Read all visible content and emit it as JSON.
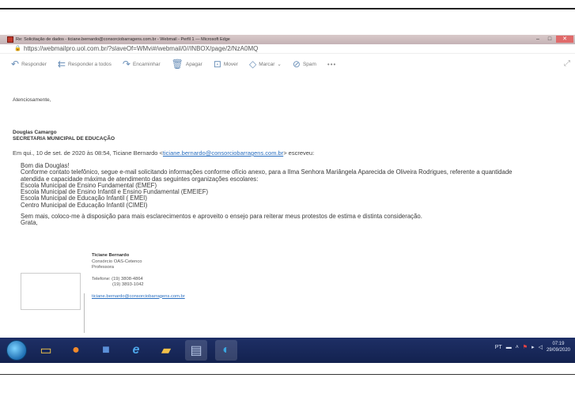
{
  "window": {
    "title": "Re: Solicitação de dados - ticiane.bernardo@consorciobarragens.com.br - Webmail - Perfil 1 — Microsoft Edge",
    "minimize": "–",
    "maximize": "□",
    "close": "✕"
  },
  "address": {
    "url": "https://webmailpro.uol.com.br/?slaveOf=WMvi#/webmail/0//INBOX/page/2/NzA0MQ"
  },
  "toolbar": {
    "reply": "Responder",
    "reply_all": "Responder a todos",
    "forward": "Encaminhar",
    "delete": "Apagar",
    "move": "Mover",
    "mark": "Marcar",
    "mark_caret": "⌄",
    "spam": "Spam",
    "more": "•••"
  },
  "mail": {
    "greeting_close": "Atenciosamente,",
    "sig_name": "Douglas Camargo",
    "sig_dept": "SECRETARIA MUNICIPAL DE EDUCAÇÃO",
    "quote_header_pre": "Em qui., 10 de set. de 2020 às 08:54, Ticiane Bernardo <",
    "quote_header_link": "ticiane.bernardo@consorciobarragens.com.br",
    "quote_header_post": "> escreveu:",
    "quote_lines": [
      "Bom dia Douglas!",
      "Conforme contato telefônico, segue e-mail solicitando informações conforme ofício anexo, para a Ilma Senhora Mariângela Aparecida de Oliveira Rodrigues, referente a quantidade",
      "atendida e capacidade máxima de atendimento das seguintes organizações escolares:",
      "Escola Municipal de Ensino Fundamental (EMEF)",
      "Escola Municipal de Ensino Infantil e Ensino Fundamental (EMEIEF)",
      "Escola Municipal de Educação Infantil ( EMEI)",
      "Centro Municipal de Educação Infantil (CIMEI)"
    ],
    "closing_line": "Sem mais, coloco-me à disposição para mais esclarecimentos e aproveito o ensejo para reiterar meus protestos de estima e distinta consideração.",
    "thanks": "Grata,",
    "sig2_name": "Ticiane Bernardo",
    "sig2_company": "Consórcio OAS-Cetenco",
    "sig2_role": "Professora",
    "sig2_phone1": "Telefone: (19) 3808-4864",
    "sig2_phone2": "(19) 3893-1042",
    "sig2_email": "ticiane.bernardo@consorciobarragens.com.br"
  },
  "tray": {
    "lang": "PT",
    "time": "07:19",
    "date": "29/09/2020"
  },
  "colors": {
    "taskbar": "#13224f",
    "link": "#2a6fc0",
    "titlebar": "#c4b2b5"
  }
}
